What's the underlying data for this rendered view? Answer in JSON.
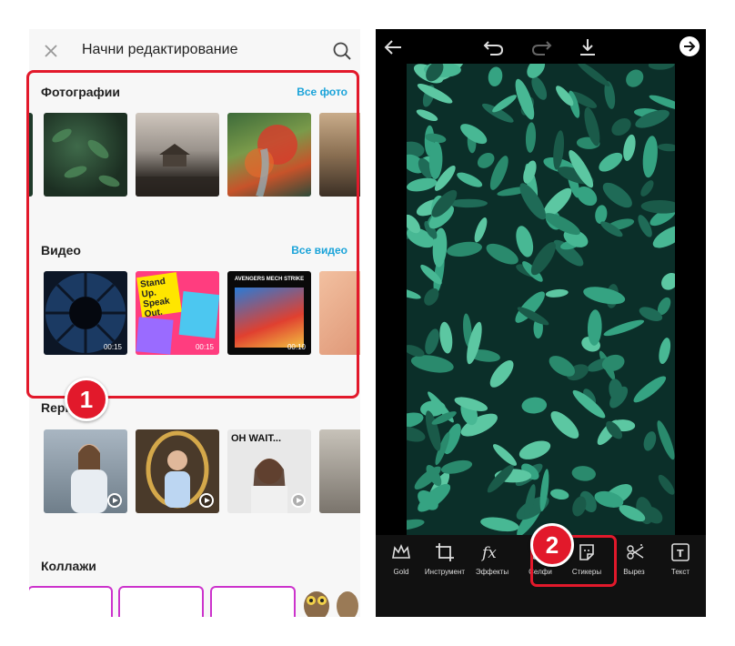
{
  "left_screen": {
    "header": {
      "title": "Начни редактирование"
    },
    "photos": {
      "title": "Фотографии",
      "see_all": "Все фото"
    },
    "videos": {
      "title": "Видео",
      "see_all": "Все видео",
      "items": [
        {
          "duration": "00:15"
        },
        {
          "duration": "00:15",
          "sticker_text": "Stand Up. Speak Out."
        },
        {
          "duration": "00:10",
          "title": "AVENGERS MECH STRIKE"
        }
      ]
    },
    "replay": {
      "title": "Repla",
      "overlay_text": "OH WAIT..."
    },
    "collages": {
      "title": "Коллажи"
    }
  },
  "right_screen": {
    "toolbar": [
      {
        "icon": "crown-icon",
        "label": "Gold"
      },
      {
        "icon": "crop-icon",
        "label": "Инструмент"
      },
      {
        "icon": "fx-icon",
        "label": "Эффекты"
      },
      {
        "icon": "selfie-icon",
        "label": "Селфи"
      },
      {
        "icon": "sticker-icon",
        "label": "Стикеры"
      },
      {
        "icon": "cutout-icon",
        "label": "Вырез"
      },
      {
        "icon": "text-icon",
        "label": "Текст"
      }
    ]
  },
  "annotations": {
    "badge_1": "1",
    "badge_2": "2"
  },
  "colors": {
    "annotation_red": "#e2192b",
    "link_blue": "#1aa3d9",
    "leaf_green": "#2a9e7a"
  }
}
